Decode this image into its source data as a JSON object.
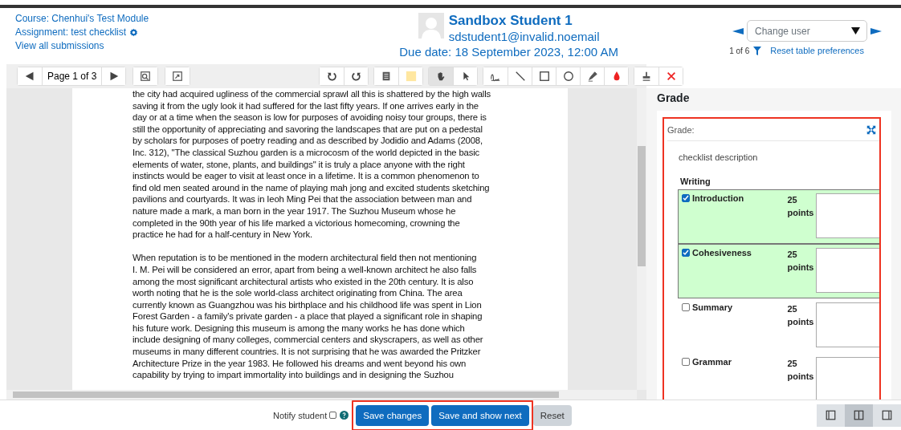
{
  "header": {
    "links": [
      "Course: Chenhui's Test Module",
      "Assignment: test checklist",
      "View all submissions"
    ],
    "student": {
      "name": "Sandbox Student 1",
      "email": "sdstudent1@invalid.noemail",
      "due_date": "Due date: 18 September 2023, 12:00 AM"
    },
    "user_select": {
      "placeholder": "Change user"
    },
    "user_count": "1 of 6",
    "reset_link": "Reset table preferences"
  },
  "toolbar": {
    "page_label": "Page 1 of 3",
    "tools": [
      {
        "kind": "rotate-left",
        "selected": false
      },
      {
        "kind": "rotate-right",
        "selected": false
      },
      {
        "kind": "comment",
        "selected": false
      },
      {
        "kind": "swatch",
        "selected": false
      },
      {
        "kind": "pan",
        "selected": true
      },
      {
        "kind": "select",
        "selected": false
      },
      {
        "kind": "pen",
        "selected": false
      },
      {
        "kind": "line",
        "selected": false
      },
      {
        "kind": "rectangle",
        "selected": false
      },
      {
        "kind": "oval",
        "selected": false
      },
      {
        "kind": "highlight",
        "selected": false
      },
      {
        "kind": "drop",
        "selected": false
      },
      {
        "kind": "stamp",
        "selected": false
      },
      {
        "kind": "delete",
        "selected": false
      }
    ]
  },
  "document": {
    "paragraphs": [
      {
        "lines": [
          "the city had acquired ugliness of the commercial sprawl all this is shattered by the high walls",
          "saving it from the ugly look it had suffered for the last fifty years. If one arrives early in the",
          "day or at a time when the season is low for purposes of avoiding noisy tour groups, there is",
          "still the opportunity of appreciating and savoring the landscapes that are put on a pedestal",
          "by scholars for purposes of poetry reading and as described by Jodidio and Adams (2008,",
          "Inc. 312), \"The classical Suzhou garden is a microcosm of the world depicted in the basic",
          "elements of water, stone, plants, and buildings\" it is truly a place anyone with the right",
          "instincts would be eager to visit at least once in a lifetime. It is a common phenomenon to",
          "find old men seated around in the name of playing mah jong and excited students sketching",
          "pavilions and courtyards. It was in Ieoh Ming Pei that the association between man and",
          "nature made a mark, a man born in the year 1917. The Suzhou Museum whose he",
          "completed in the 90th year of his life marked a victorious homecoming, crowning the",
          "practice he had for a half-century in New York."
        ]
      },
      {
        "lines": [
          "When reputation is to be mentioned in the modern architectural field then not mentioning",
          "I. M. Pei will be considered an error, apart from being a well-known architect he also falls",
          "among the most significant architectural artists who existed in the 20th century. It is also",
          "worth noting that he is the sole world-class architect originating from China. The area",
          "currently known as Guangzhou was his birthplace and his childhood life was spent in Lion",
          "Forest Garden - a family's private garden - a place that played a significant role in shaping",
          "his future work. Designing this museum is among the many works he has done which",
          "include designing of many colleges, commercial centers and skyscrapers, as well as other",
          "museums in many different countries. It is not surprising that he was awarded the Pritzker",
          "Architecture Prize in the year 1983. He followed his dreams and went beyond his own",
          "capability by trying to impart immortality into buildings and in designing the Suzhou"
        ]
      }
    ]
  },
  "grade_panel": {
    "title": "Grade",
    "card_title": "Grade:",
    "description": "checklist description",
    "group": "Writing",
    "items": [
      {
        "name": "Introduction",
        "points": "25 points",
        "checked": true
      },
      {
        "name": "Cohesiveness",
        "points": "25 points",
        "checked": true
      },
      {
        "name": "Summary",
        "points": "25 points",
        "checked": false
      },
      {
        "name": "Grammar",
        "points": "25 points",
        "checked": false
      }
    ]
  },
  "footer": {
    "notify_label": "Notify student",
    "notify_checked": false,
    "buttons": [
      {
        "label": "Save changes",
        "kind": "primary"
      },
      {
        "label": "Save and show next",
        "kind": "primary"
      },
      {
        "label": "Reset",
        "kind": "secondary"
      }
    ],
    "layouts": [
      {
        "kind": "left",
        "selected": false
      },
      {
        "kind": "both",
        "selected": true
      },
      {
        "kind": "right",
        "selected": false
      }
    ]
  }
}
